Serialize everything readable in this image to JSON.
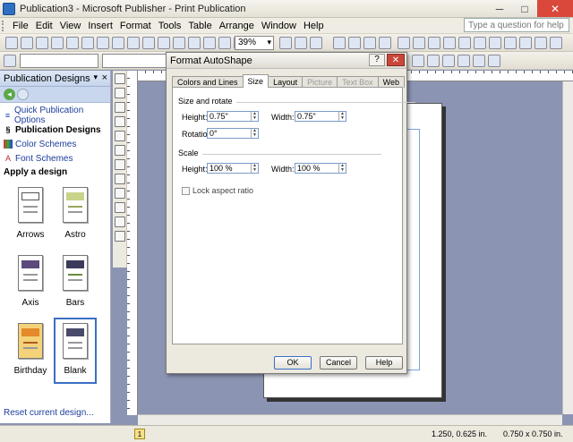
{
  "window": {
    "title": "Publication3 - Microsoft Publisher - Print Publication",
    "minimize": "─",
    "maximize": "□",
    "close": "✕"
  },
  "menu": [
    "File",
    "Edit",
    "View",
    "Insert",
    "Format",
    "Tools",
    "Table",
    "Arrange",
    "Window",
    "Help"
  ],
  "help_box": {
    "placeholder": "Type a question for help"
  },
  "toolbar": {
    "zoom": "39%"
  },
  "taskpane": {
    "title": "Publication Designs",
    "close": "×",
    "dropdown": "▾",
    "links": {
      "quick": "Quick Publication Options",
      "designs": "Publication Designs",
      "colors": "Color Schemes",
      "fonts": "Font Schemes"
    },
    "apply_label": "Apply a design",
    "designs": [
      "Arrows",
      "Astro",
      "Axis",
      "Bars",
      "Birthday",
      "Blank"
    ],
    "reset": "Reset current design..."
  },
  "dialog": {
    "title": "Format AutoShape",
    "help_button": "?",
    "close_button": "✕",
    "tabs": [
      "Colors and Lines",
      "Size",
      "Layout",
      "Picture",
      "Text Box",
      "Web"
    ],
    "section_size": "Size and rotate",
    "height_label": "Height:",
    "height_value": "0.75\"",
    "width_label": "Width:",
    "width_value": "0.75\"",
    "rotation_label": "Rotation:",
    "rotation_value": "0°",
    "section_scale": "Scale",
    "scale_height_label": "Height:",
    "scale_height_value": "100 %",
    "scale_width_label": "Width:",
    "scale_width_value": "100 %",
    "lock_label": "Lock aspect ratio",
    "ok": "OK",
    "cancel": "Cancel",
    "help": "Help"
  },
  "status": {
    "page": "1",
    "position": "1.250, 0.625 in.",
    "size": "0.750 x 0.750 in."
  }
}
